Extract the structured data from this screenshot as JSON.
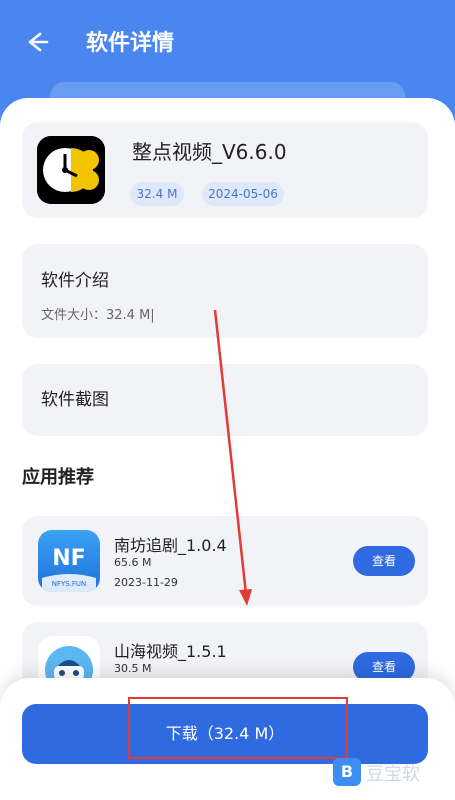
{
  "header": {
    "title": "软件详情"
  },
  "app": {
    "name": "整点视频_V6.6.0",
    "size_tag": "32.4 M",
    "date_tag": "2024-05-06"
  },
  "intro": {
    "title": "软件介绍",
    "file_size_line": "文件大小：32.4 M|"
  },
  "screenshots": {
    "title": "软件截图"
  },
  "recommend": {
    "title": "应用推荐",
    "items": [
      {
        "name": "南坊追剧_1.0.4",
        "size": "65.6 M",
        "date": "2023-11-29",
        "button": "查看",
        "icon_text": "NF",
        "icon_subtext": "NFYS.FUN"
      },
      {
        "name": "山海视频_1.5.1",
        "size": "30.5 M",
        "date": "",
        "button": "查看"
      }
    ]
  },
  "download": {
    "label": "下载（32.4 M）"
  },
  "watermark": {
    "logo_letter": "B",
    "text": "豆宝软"
  },
  "colors": {
    "header": "#4a86f0",
    "accent": "#2f6ae0",
    "annotation": "#e53935"
  }
}
